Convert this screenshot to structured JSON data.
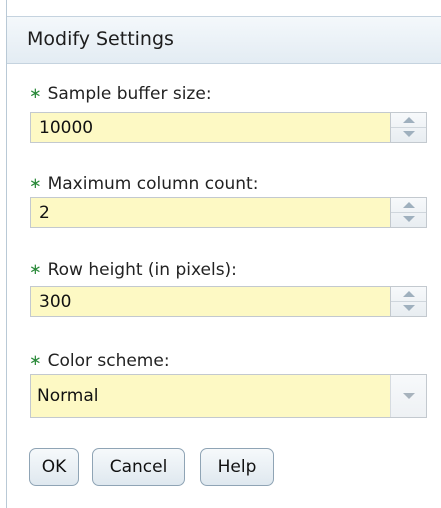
{
  "dialog": {
    "title": "Modify Settings",
    "required_marker": "∗"
  },
  "fields": [
    {
      "label": "Sample buffer size:",
      "value": "10000"
    },
    {
      "label": "Maximum column count:",
      "value": "2"
    },
    {
      "label": "Row height (in pixels):",
      "value": "300"
    }
  ],
  "color_scheme": {
    "label": "Color scheme:",
    "selected": "Normal"
  },
  "buttons": {
    "ok": "OK",
    "cancel": "Cancel",
    "help": "Help"
  },
  "colors": {
    "input_background": "#fdf9c4",
    "required_marker": "#2a8a3a",
    "title_bar": "#e3ecf3"
  }
}
